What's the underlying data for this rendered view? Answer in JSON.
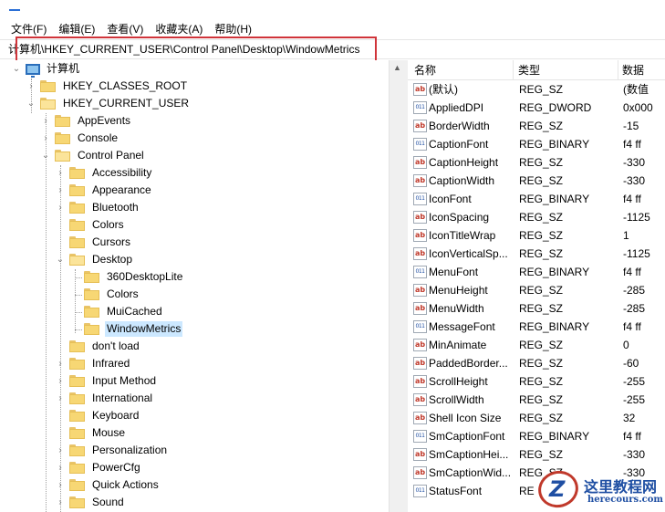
{
  "menu": {
    "items": [
      "文件(F)",
      "编辑(E)",
      "查看(V)",
      "收藏夹(A)",
      "帮助(H)"
    ]
  },
  "address": {
    "path": "计算机\\HKEY_CURRENT_USER\\Control Panel\\Desktop\\WindowMetrics"
  },
  "tree": {
    "root": "计算机",
    "nodes": {
      "hkcr": "HKEY_CLASSES_ROOT",
      "hkcu": "HKEY_CURRENT_USER",
      "appevents": "AppEvents",
      "console": "Console",
      "controlpanel": "Control Panel",
      "accessibility": "Accessibility",
      "appearance": "Appearance",
      "bluetooth": "Bluetooth",
      "colors": "Colors",
      "cursors": "Cursors",
      "desktop": "Desktop",
      "desktop360": "360DesktopLite",
      "desktopcolors": "Colors",
      "muicached": "MuiCached",
      "windowmetrics": "WindowMetrics",
      "dontload": "don't load",
      "infrared": "Infrared",
      "inputmethod": "Input Method",
      "international": "International",
      "keyboard": "Keyboard",
      "mouse": "Mouse",
      "personalization": "Personalization",
      "powercfg": "PowerCfg",
      "quickactions": "Quick Actions",
      "sound": "Sound"
    }
  },
  "list": {
    "headers": {
      "name": "名称",
      "type": "类型",
      "data": "数据"
    },
    "rows": [
      {
        "icon": "string-value-icon",
        "name": "(默认)",
        "type": "REG_SZ",
        "data": "(数值"
      },
      {
        "icon": "binary-value-icon",
        "name": "AppliedDPI",
        "type": "REG_DWORD",
        "data": "0x000"
      },
      {
        "icon": "string-value-icon",
        "name": "BorderWidth",
        "type": "REG_SZ",
        "data": "-15"
      },
      {
        "icon": "binary-value-icon",
        "name": "CaptionFont",
        "type": "REG_BINARY",
        "data": "f4 ff"
      },
      {
        "icon": "string-value-icon",
        "name": "CaptionHeight",
        "type": "REG_SZ",
        "data": "-330"
      },
      {
        "icon": "string-value-icon",
        "name": "CaptionWidth",
        "type": "REG_SZ",
        "data": "-330"
      },
      {
        "icon": "binary-value-icon",
        "name": "IconFont",
        "type": "REG_BINARY",
        "data": "f4 ff"
      },
      {
        "icon": "string-value-icon",
        "name": "IconSpacing",
        "type": "REG_SZ",
        "data": "-1125"
      },
      {
        "icon": "string-value-icon",
        "name": "IconTitleWrap",
        "type": "REG_SZ",
        "data": "1"
      },
      {
        "icon": "string-value-icon",
        "name": "IconVerticalSp...",
        "type": "REG_SZ",
        "data": "-1125"
      },
      {
        "icon": "binary-value-icon",
        "name": "MenuFont",
        "type": "REG_BINARY",
        "data": "f4 ff"
      },
      {
        "icon": "string-value-icon",
        "name": "MenuHeight",
        "type": "REG_SZ",
        "data": "-285"
      },
      {
        "icon": "string-value-icon",
        "name": "MenuWidth",
        "type": "REG_SZ",
        "data": "-285"
      },
      {
        "icon": "binary-value-icon",
        "name": "MessageFont",
        "type": "REG_BINARY",
        "data": "f4 ff"
      },
      {
        "icon": "string-value-icon",
        "name": "MinAnimate",
        "type": "REG_SZ",
        "data": "0"
      },
      {
        "icon": "string-value-icon",
        "name": "PaddedBorder...",
        "type": "REG_SZ",
        "data": "-60"
      },
      {
        "icon": "string-value-icon",
        "name": "ScrollHeight",
        "type": "REG_SZ",
        "data": "-255"
      },
      {
        "icon": "string-value-icon",
        "name": "ScrollWidth",
        "type": "REG_SZ",
        "data": "-255"
      },
      {
        "icon": "string-value-icon",
        "name": "Shell Icon Size",
        "type": "REG_SZ",
        "data": "32"
      },
      {
        "icon": "binary-value-icon",
        "name": "SmCaptionFont",
        "type": "REG_BINARY",
        "data": "f4 ff"
      },
      {
        "icon": "string-value-icon",
        "name": "SmCaptionHei...",
        "type": "REG_SZ",
        "data": "-330"
      },
      {
        "icon": "string-value-icon",
        "name": "SmCaptionWid...",
        "type": "REG_SZ",
        "data": "-330"
      },
      {
        "icon": "binary-value-icon",
        "name": "StatusFont",
        "type": "RE",
        "data": ""
      }
    ]
  },
  "icons": {
    "string_glyph": "ab",
    "binary_glyph": "011"
  },
  "watermark": {
    "logo_letter": "Z",
    "title": "这里教程网",
    "url": "herecours.com"
  },
  "colors": {
    "highlight_border": "#d0343a",
    "selection": "#cce8ff",
    "folder": "#f7d774",
    "watermark_blue": "#1f4fa3",
    "watermark_red": "#c0392b"
  }
}
